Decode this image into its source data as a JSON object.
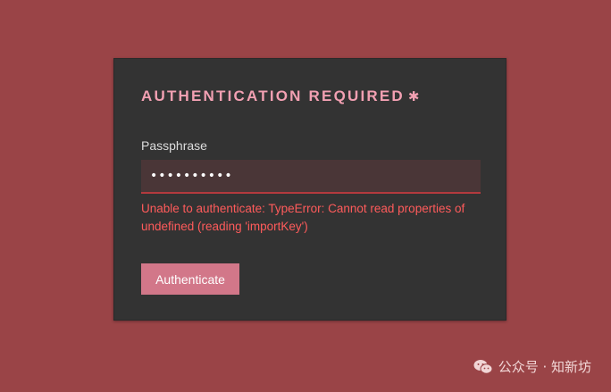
{
  "dialog": {
    "title": "AUTHENTICATION REQUIRED",
    "title_icon": "✱",
    "passphrase_label": "Passphrase",
    "passphrase_value": "••••••••••",
    "error_message": "Unable to authenticate: TypeError: Cannot read properties of undefined (reading 'importKey')",
    "authenticate_label": "Authenticate"
  },
  "watermark": {
    "text": "公众号 · 知新坊",
    "icon": "wechat-icon"
  },
  "colors": {
    "page_background": "#9a4447",
    "card_background": "#333333",
    "title_accent": "#f2a0b2",
    "input_background": "#4a3637",
    "input_underline": "#b33a3e",
    "error_text": "#ff5b5b",
    "button_background": "#d27789"
  }
}
